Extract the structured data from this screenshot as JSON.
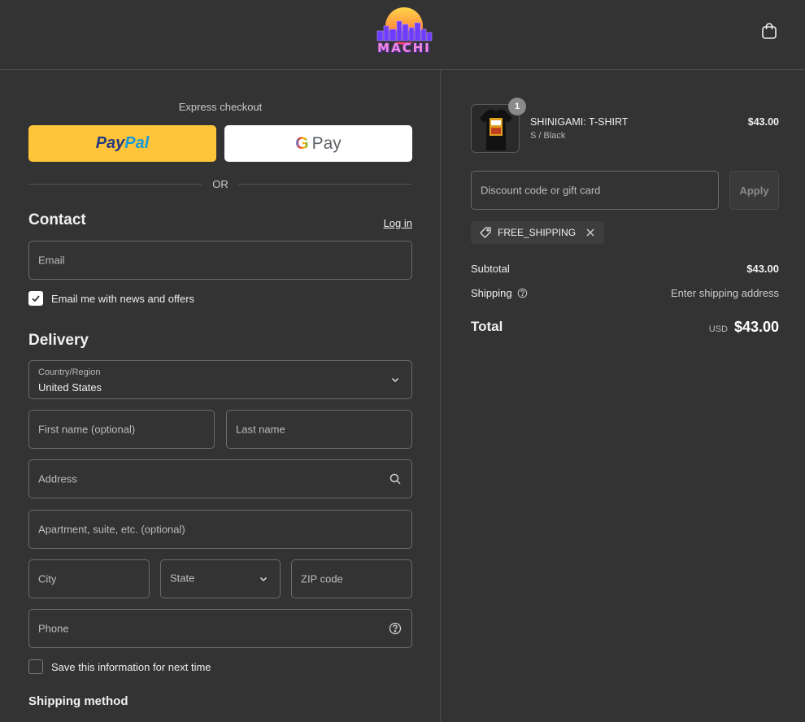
{
  "header": {
    "logo_text": "MACHI",
    "cart_icon": "shopping-bag-icon"
  },
  "express": {
    "label": "Express checkout",
    "paypal_part1": "Pay",
    "paypal_part2": "Pal",
    "gpay_g": "G",
    "gpay_label": "Pay",
    "or_label": "OR"
  },
  "contact": {
    "title": "Contact",
    "login_label": "Log in",
    "email_placeholder": "Email",
    "newsletter_label": "Email me with news and offers",
    "newsletter_checked": true
  },
  "delivery": {
    "title": "Delivery",
    "country_label": "Country/Region",
    "country_value": "United States",
    "first_name_placeholder": "First name (optional)",
    "last_name_placeholder": "Last name",
    "address_placeholder": "Address",
    "apartment_placeholder": "Apartment, suite, etc. (optional)",
    "city_placeholder": "City",
    "state_placeholder": "State",
    "zip_placeholder": "ZIP code",
    "phone_placeholder": "Phone",
    "save_info_label": "Save this information for next time",
    "save_info_checked": false
  },
  "shipping_method": {
    "title": "Shipping method"
  },
  "order": {
    "product_name": "SHINIGAMI: T-SHIRT",
    "product_variant": "S / Black",
    "product_price": "$43.00",
    "quantity": "1",
    "discount_placeholder": "Discount code or gift card",
    "apply_label": "Apply",
    "applied_code": "FREE_SHIPPING",
    "subtotal_label": "Subtotal",
    "subtotal_value": "$43.00",
    "shipping_label": "Shipping",
    "shipping_value": "Enter shipping address",
    "total_label": "Total",
    "total_currency": "USD",
    "total_value": "$43.00"
  },
  "colors": {
    "background": "#333333",
    "paypal_yellow": "#ffc439",
    "gpay_white": "#ffffff"
  }
}
